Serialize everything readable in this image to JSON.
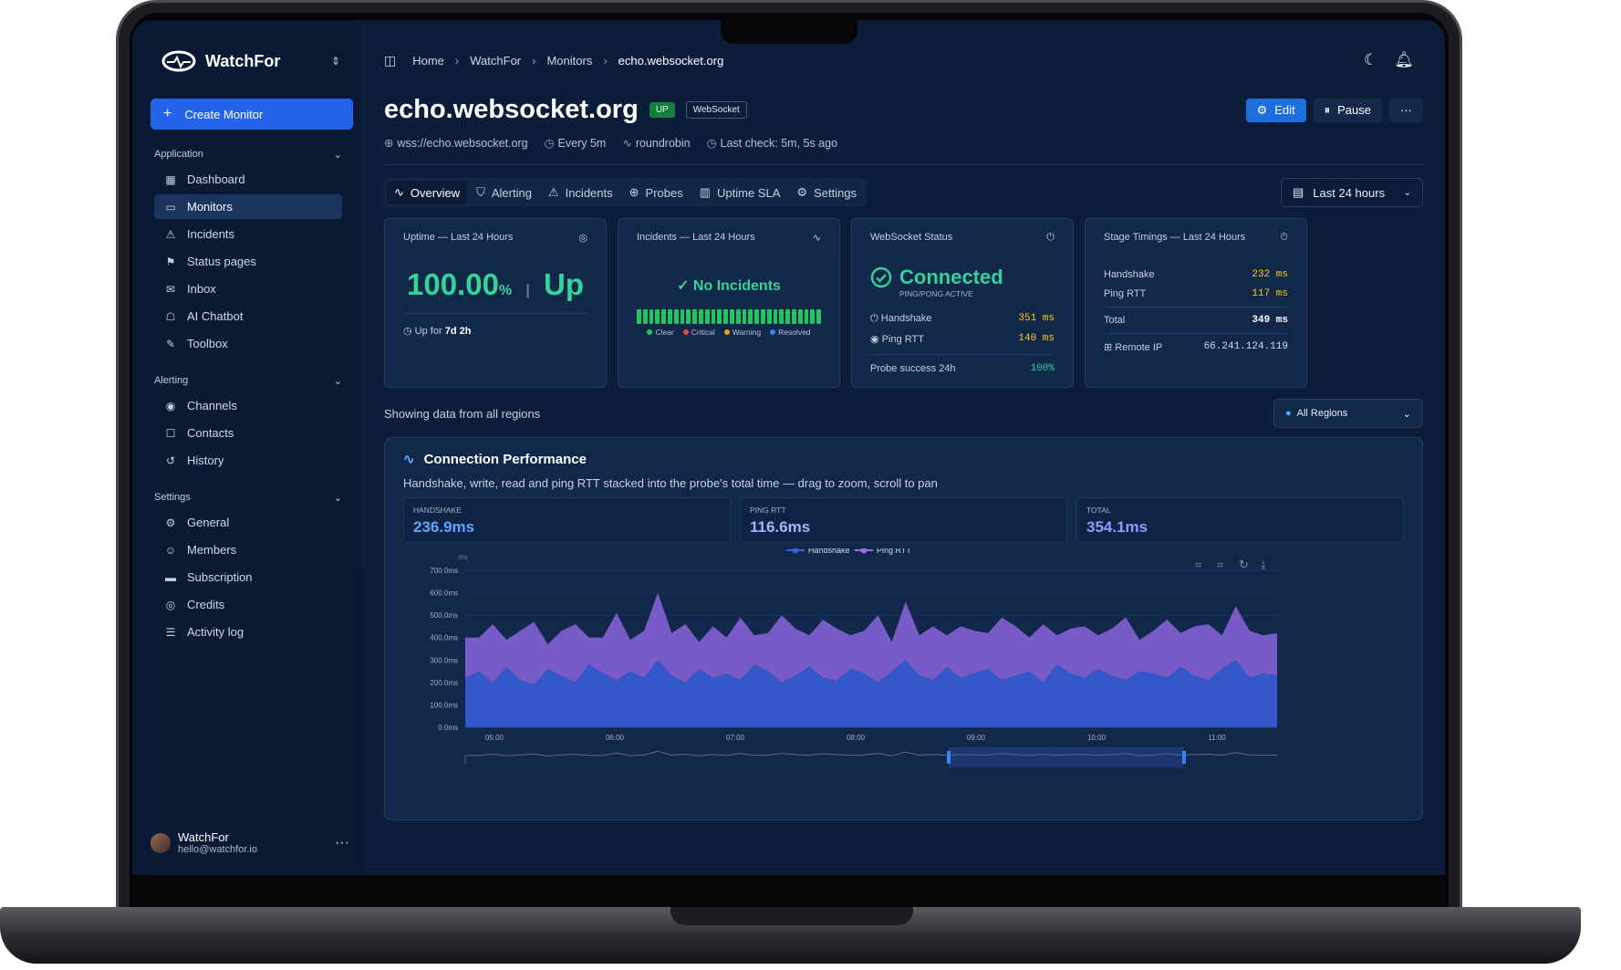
{
  "app": {
    "name": "WatchFor"
  },
  "sidebar": {
    "create_label": "Create Monitor",
    "sections": [
      {
        "title": "Application",
        "items": [
          {
            "label": "Dashboard",
            "icon": "dashboard-icon",
            "glyph": "▦"
          },
          {
            "label": "Monitors",
            "icon": "monitor-icon",
            "glyph": "▭",
            "active": true
          },
          {
            "label": "Incidents",
            "icon": "siren-icon",
            "glyph": "⚠"
          },
          {
            "label": "Status pages",
            "icon": "megaphone-icon",
            "glyph": "⚑"
          },
          {
            "label": "Inbox",
            "icon": "inbox-icon",
            "glyph": "✉"
          },
          {
            "label": "AI Chatbot",
            "icon": "bot-icon",
            "glyph": "☖"
          },
          {
            "label": "Toolbox",
            "icon": "wrench-icon",
            "glyph": "✎"
          }
        ]
      },
      {
        "title": "Alerting",
        "items": [
          {
            "label": "Channels",
            "icon": "radio-icon",
            "glyph": "◉"
          },
          {
            "label": "Contacts",
            "icon": "contact-icon",
            "glyph": "☐"
          },
          {
            "label": "History",
            "icon": "history-icon",
            "glyph": "↺"
          }
        ]
      },
      {
        "title": "Settings",
        "items": [
          {
            "label": "General",
            "icon": "gear-icon",
            "glyph": "⚙"
          },
          {
            "label": "Members",
            "icon": "users-icon",
            "glyph": "☺"
          },
          {
            "label": "Subscription",
            "icon": "card-icon",
            "glyph": "▬"
          },
          {
            "label": "Credits",
            "icon": "coins-icon",
            "glyph": "◎"
          },
          {
            "label": "Activity log",
            "icon": "log-icon",
            "glyph": "☰"
          }
        ]
      }
    ],
    "user": {
      "name": "WatchFor",
      "email": "hello@watchfor.io"
    }
  },
  "breadcrumb": [
    "Home",
    "WatchFor",
    "Monitors",
    "echo.websocket.org"
  ],
  "monitor": {
    "title": "echo.websocket.org",
    "status": "UP",
    "type": "WebSocket",
    "url": "wss://echo.websocket.org",
    "interval": "Every 5m",
    "strategy": "roundrobin",
    "last_check": "Last check: 5m, 5s ago",
    "edit_label": "Edit",
    "pause_label": "Pause",
    "more_label": "···"
  },
  "tabs": [
    {
      "label": "Overview",
      "icon": "activity-icon",
      "glyph": "∿",
      "active": true
    },
    {
      "label": "Alerting",
      "icon": "shield-icon",
      "glyph": "⛉"
    },
    {
      "label": "Incidents",
      "icon": "siren-icon",
      "glyph": "⚠"
    },
    {
      "label": "Probes",
      "icon": "globe-icon",
      "glyph": "⊕"
    },
    {
      "label": "Uptime SLA",
      "icon": "bar-chart-icon",
      "glyph": "▥"
    },
    {
      "label": "Settings",
      "icon": "gear-icon",
      "glyph": "⚙"
    }
  ],
  "time_range": "Last 24 hours",
  "cards": {
    "uptime": {
      "title": "Uptime — Last 24 Hours",
      "value": "100.00",
      "unit": "%",
      "sep": "|",
      "state": "Up",
      "up_for_label": "Up for",
      "up_for_value": "7d 2h"
    },
    "incidents": {
      "title": "Incidents — Last 24 Hours",
      "summary": "No Incidents",
      "bar_count": 30,
      "legend": [
        {
          "label": "Clear",
          "color": "#22c55e"
        },
        {
          "label": "Critical",
          "color": "#ef4444"
        },
        {
          "label": "Warning",
          "color": "#f59e0b"
        },
        {
          "label": "Resolved",
          "color": "#3b82f6"
        }
      ]
    },
    "websocket": {
      "title": "WebSocket Status",
      "state": "Connected",
      "sub": "PING/PONG ACTIVE",
      "handshake_label": "Handshake",
      "handshake_value": "351 ms",
      "ping_label": "Ping RTT",
      "ping_value": "140 ms",
      "probe_label": "Probe success 24h",
      "probe_value": "100%"
    },
    "timings": {
      "title": "Stage Timings — Last 24 Hours",
      "handshake_label": "Handshake",
      "handshake_value": "232 ms",
      "ping_label": "Ping RTT",
      "ping_value": "117 ms",
      "total_label": "Total",
      "total_value": "349 ms",
      "ip_label": "Remote IP",
      "ip_value": "66.241.124.119"
    }
  },
  "regions": {
    "text": "Showing data from all regions",
    "selected": "All Regions"
  },
  "performance": {
    "title": "Connection Performance",
    "description": "Handshake, write, read and ping RTT stacked into the probe's total time — drag to zoom, scroll to pan",
    "stats": [
      {
        "label": "HANDSHAKE",
        "value": "236.9ms"
      },
      {
        "label": "PING RTT",
        "value": "116.6ms"
      },
      {
        "label": "TOTAL",
        "value": "354.1ms"
      }
    ]
  },
  "chart_data": {
    "type": "area",
    "ylabel": "ms",
    "ylim": [
      0,
      700
    ],
    "y_ticks": [
      "0.0ms",
      "100.0ms",
      "200.0ms",
      "300.0ms",
      "400.0ms",
      "500.0ms",
      "600.0ms",
      "700.0ms"
    ],
    "x_ticks": [
      "05:00",
      "06:00",
      "07:00",
      "08:00",
      "09:00",
      "10:00",
      "11:00"
    ],
    "legend_position": "top-center",
    "colors": {
      "handshake": "#3b5fe0",
      "ping": "#9b6cf0"
    },
    "series": [
      {
        "name": "Handshake",
        "values": [
          220,
          250,
          200,
          270,
          210,
          190,
          260,
          230,
          200,
          280,
          240,
          210,
          250,
          220,
          300,
          230,
          200,
          260,
          220,
          240,
          210,
          280,
          250,
          200,
          230,
          270,
          220,
          210,
          260,
          240,
          200,
          250,
          300,
          230,
          210,
          270,
          220,
          240,
          260,
          210,
          230,
          250,
          200,
          280,
          240,
          220,
          260,
          230,
          210,
          250,
          240,
          220,
          270,
          230,
          210,
          260,
          300,
          220,
          240,
          230
        ]
      },
      {
        "name": "Ping RTT",
        "values": [
          180,
          150,
          260,
          120,
          220,
          280,
          110,
          200,
          260,
          120,
          160,
          300,
          140,
          210,
          300,
          190,
          260,
          120,
          230,
          160,
          280,
          130,
          170,
          300,
          210,
          140,
          260,
          230,
          150,
          190,
          300,
          130,
          260,
          180,
          240,
          140,
          230,
          190,
          160,
          280,
          220,
          150,
          260,
          130,
          200,
          230,
          150,
          210,
          280,
          140,
          190,
          260,
          150,
          220,
          250,
          150,
          240,
          210,
          170,
          190
        ]
      }
    ]
  }
}
